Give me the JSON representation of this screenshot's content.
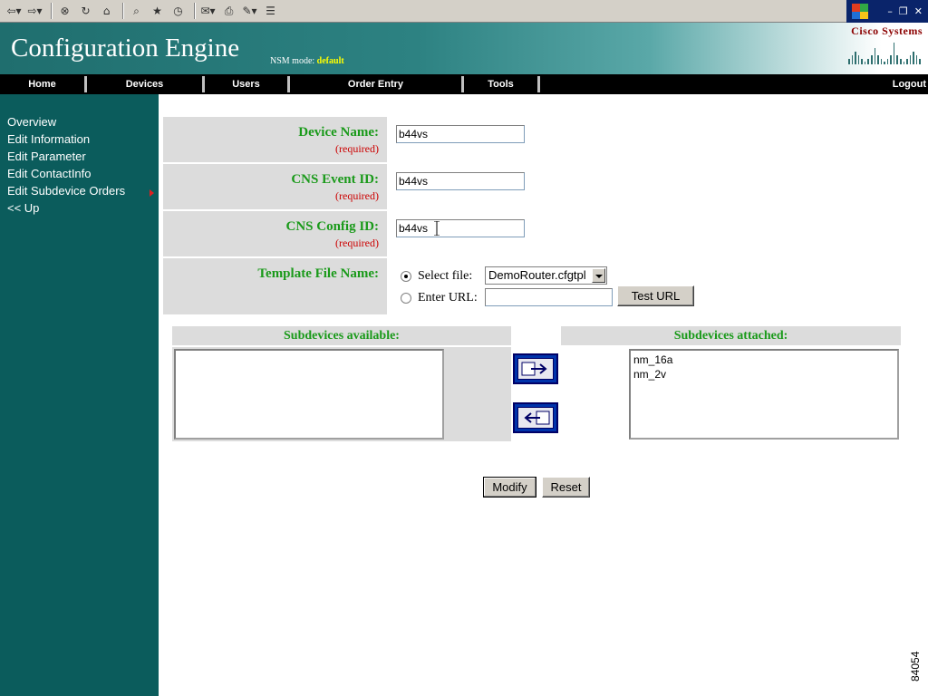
{
  "browser": {
    "icons": [
      "back-icon",
      "forward-icon",
      "stop-icon",
      "refresh-icon",
      "home-icon",
      "search-icon",
      "favorites-icon",
      "history-icon",
      "mail-icon",
      "print-icon",
      "edit-icon",
      "discuss-icon"
    ],
    "window_controls": [
      "minimize-icon",
      "restore-icon",
      "close-icon"
    ]
  },
  "header": {
    "title": "Configuration Engine",
    "nsm_label": "NSM mode:",
    "nsm_value": "default",
    "logo_text": "Cisco Systems"
  },
  "nav": {
    "items": [
      "Home",
      "Devices",
      "Users",
      "Order Entry",
      "Tools"
    ],
    "logout": "Logout"
  },
  "sidebar": {
    "items": [
      "Overview",
      "Edit Information",
      "Edit Parameter",
      "Edit ContactInfo",
      "Edit Subdevice Orders",
      "<< Up"
    ]
  },
  "form": {
    "device_name": {
      "label": "Device Name:",
      "required": "(required)",
      "value": "b44vs"
    },
    "event_id": {
      "label": "CNS Event ID:",
      "required": "(required)",
      "value": "b44vs"
    },
    "config_id": {
      "label": "CNS Config ID:",
      "required": "(required)",
      "value": "b44vs"
    },
    "template": {
      "label": "Template File Name:",
      "select_file_label": "Select file:",
      "selected_file": "DemoRouter.cfgtpl",
      "enter_url_label": "Enter URL:",
      "url_value": "",
      "test_url_button": "Test URL"
    }
  },
  "subdevices": {
    "available_header": "Subdevices available:",
    "attached_header": "Subdevices attached:",
    "available": [],
    "attached": [
      "nm_16a",
      "nm_2v"
    ]
  },
  "actions": {
    "modify": "Modify",
    "reset": "Reset"
  },
  "figure_id": "84054"
}
